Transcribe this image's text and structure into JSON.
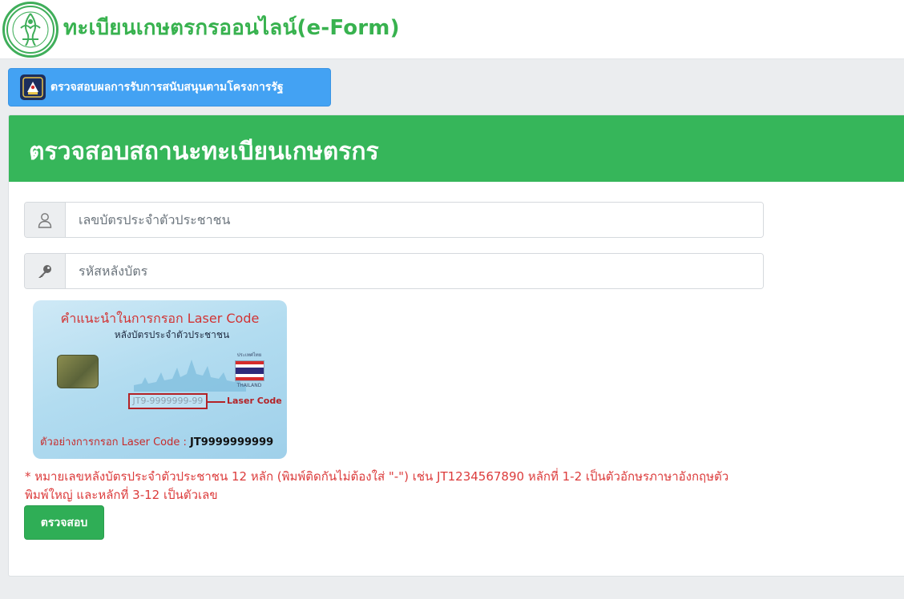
{
  "header": {
    "logo_icon": "agriculture-ministry-seal-icon",
    "title": "ทะเบียนเกษตรกรออนไลน์(e-Form)"
  },
  "support_button": {
    "icon": "government-project-emblem-icon",
    "label": "ตรวจสอบผลการรับการสนับสนุนตามโครงการรัฐ"
  },
  "panel": {
    "title": "ตรวจสอบสถานะทะเบียนเกษตรกร",
    "id_field": {
      "icon": "user-icon",
      "placeholder": "เลขบัตรประจำตัวประชาชน",
      "value": ""
    },
    "laser_field": {
      "icon": "key-icon",
      "placeholder": "รหัสหลังบัตร",
      "value": ""
    },
    "card_example": {
      "title": "คำแนะนำในการกรอก Laser Code",
      "subtitle": "หลังบัตรประจำตัวประชาชน",
      "flag_top": "ประเทศไทย",
      "flag_bottom": "THAILAND",
      "code_sample": "JT9-9999999-99",
      "code_tag": "Laser Code",
      "example_label": "ตัวอย่างการกรอก Laser Code : ",
      "example_value": "JT9999999999"
    },
    "note": "* หมายเลขหลังบัตรประจำตัวประชาชน 12 หลัก (พิมพ์ติดกันไม่ต้องใส่ \"-\") เช่น JT1234567890 หลักที่ 1-2 เป็นตัวอักษรภาษาอังกฤษตัวพิมพ์ใหญ่ และหลักที่ 3-12 เป็นตัวเลข",
    "submit_label": "ตรวจสอบ"
  },
  "colors": {
    "brand_green": "#36b65a",
    "title_green": "#38b24f",
    "button_blue": "#43a2f3",
    "note_red": "#dc3c3c",
    "page_background": "#ebedef"
  }
}
